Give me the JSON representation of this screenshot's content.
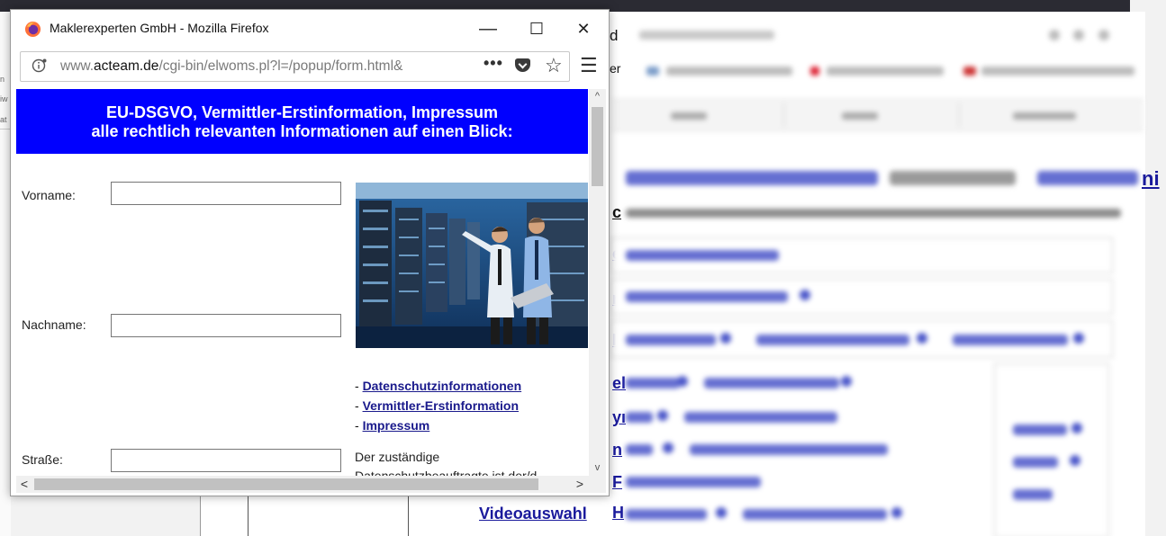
{
  "window": {
    "title": "Maklerexperten GmbH - Mozilla Firefox",
    "minimize_glyph": "—",
    "maximize_glyph": "☐",
    "close_glyph": "✕"
  },
  "urlbar": {
    "info_icon": "info-icon",
    "url_prefix": "www.",
    "url_domain": "acteam.de",
    "url_path": "/cgi-bin/elwoms.pl?l=/popup/form.html&",
    "more_glyph": "•••",
    "star_glyph": "☆",
    "menu_glyph": "☰"
  },
  "page": {
    "header_line1": "EU-DSGVO, Vermittler-Erstinformation, Impressum",
    "header_line2": "alle rechtlich relevanten Informationen auf einen Blick:",
    "fields": {
      "vorname_label": "Vorname:",
      "vorname_value": "",
      "nachname_label": "Nachname:",
      "nachname_value": "",
      "strasse_label": "Straße:",
      "strasse_value": ""
    },
    "links": {
      "prefix": "- ",
      "datenschutz": "Datenschutzinformationen",
      "vermittler": "Vermittler-Erstinformation",
      "impressum": "Impressum"
    },
    "text_line1": "Der zuständige",
    "text_line2": "Datenschutzbeauftragte ist der/d"
  },
  "scrollbars": {
    "up_glyph": "^",
    "down_glyph": "v",
    "left_glyph": "<",
    "right_glyph": ">"
  },
  "background": {
    "visible_partial_texts": [
      "d",
      "er",
      "ni",
      "c",
      "el",
      "rı",
      "Iı",
      "el",
      "yı",
      "n",
      "F",
      "H"
    ],
    "bottom_link": "Videoauswahl",
    "left_strip_texts": [
      "n",
      "iw",
      "at"
    ]
  },
  "colors": {
    "header_bg": "#0000ff",
    "link": "#1a1a8c",
    "firefox_orange": "#ff7139",
    "firefox_purple": "#6e2ea5"
  }
}
